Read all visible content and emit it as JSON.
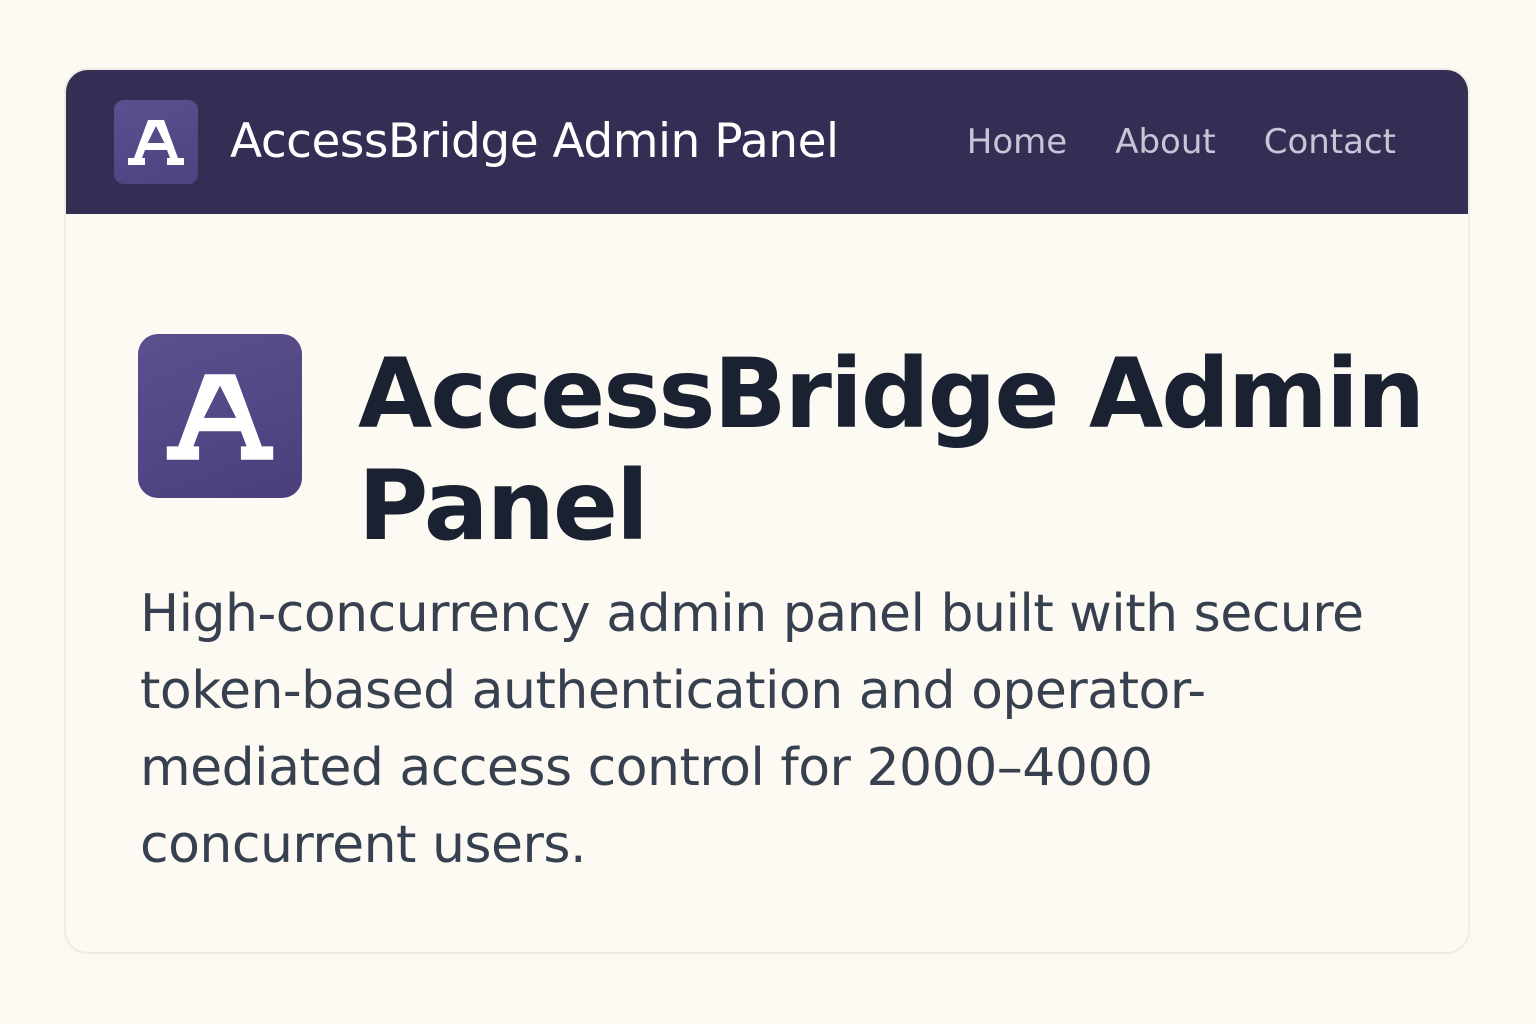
{
  "navbar": {
    "logo_icon": "letter-a-logo-icon",
    "title": "AccessBridge Admin Panel",
    "links": [
      {
        "label": "Home"
      },
      {
        "label": "About"
      },
      {
        "label": "Contact"
      }
    ]
  },
  "hero": {
    "logo_icon": "letter-a-logo-icon",
    "title": "AccessBridge Admin Panel",
    "description": "High-concurrency admin panel built with secure token-based authentication and operator-mediated access control for 2000–4000 concurrent users."
  },
  "colors": {
    "page_background": "#fcf8f2",
    "navbar_background": "#342d54",
    "logo_background": "#554984",
    "title_text": "#1a2130",
    "body_text": "#37404f",
    "nav_link_text": "#c9c4d6"
  }
}
